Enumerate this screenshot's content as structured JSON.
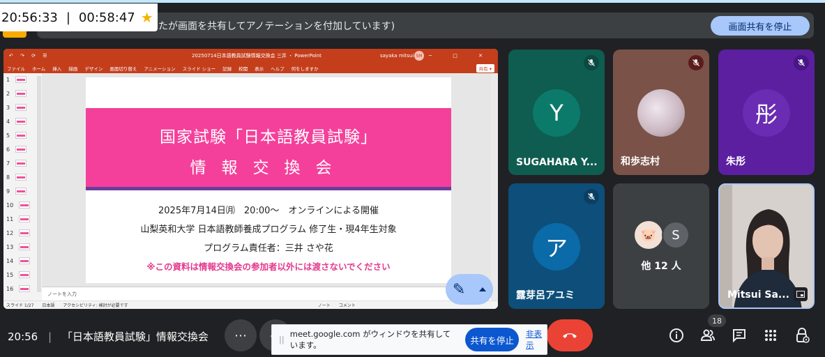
{
  "timer": {
    "elapsed": "20:56:33",
    "separator": "|",
    "remaining": "00:58:47",
    "star_icon": "star-icon"
  },
  "banner": {
    "text": "たが画面を共有してアノテーションを付加しています)",
    "stop_button": "画面共有を停止"
  },
  "ppt": {
    "quick_access": "↶ ↷ ⟳ ☰",
    "filename": "20250714日本語教員試験情報交換会 三井 ・ PowerPoint",
    "user": "sayaka mitsui",
    "user_initials": "SM",
    "window_controls": "─ □ ✕",
    "ribbon_tabs": [
      "ファイル",
      "ホーム",
      "挿入",
      "描画",
      "デザイン",
      "画面切り替え",
      "アニメーション",
      "スライド ショー",
      "記録",
      "校閲",
      "表示",
      "ヘルプ",
      "何をしますか"
    ],
    "share_label": "共有 ▾",
    "thumbnails": [
      "1",
      "2",
      "3",
      "4",
      "5",
      "6",
      "7",
      "8",
      "9",
      "10",
      "11",
      "12",
      "13",
      "14",
      "15",
      "16"
    ],
    "slide": {
      "title1": "国家試験「日本語教員試験」",
      "title2": "情報交換会",
      "line1": "2025年7月14日㈪　20:00～　オンラインによる開催",
      "line2": "山梨英和大学 日本語教師養成プログラム 修了生・現4年生対象",
      "line3": "プログラム責任者：三井 さや花",
      "note": "※この資料は情報交換会の参加者以外には渡さないでください"
    },
    "notes_placeholder": "ノートを入力",
    "status": [
      "スライド 1/27",
      "日本語",
      "アクセシビリティ: 検討が必要です",
      "ノート",
      "コメント"
    ]
  },
  "tiles": [
    {
      "name": "SUGAHARA Y...",
      "initial": "Y",
      "bg": "#0f5c50",
      "avatar_bg": "#0c7a6a",
      "muted": true
    },
    {
      "name": "和歩志村",
      "initial": "",
      "bg": "#7a5248",
      "avatar_bg": "#d9c8cf",
      "muted": true
    },
    {
      "name": "朱彤",
      "initial": "彤",
      "bg": "#5b1fa0",
      "avatar_bg": "#6a2cb3",
      "muted": true
    },
    {
      "name": "露芽呂アユミ",
      "initial": "ア",
      "bg": "#0d4f7a",
      "avatar_bg": "#0b6aa8",
      "muted": true
    },
    {
      "name": "他 12 人",
      "initial": "S",
      "bg": "#3c4043",
      "avatar_bg": "#5f6368",
      "muted": false
    },
    {
      "name": "Mitsui Sa...",
      "initial": "",
      "bg": "#c9c4c0",
      "avatar_bg": "",
      "muted": false
    }
  ],
  "bottom": {
    "time": "20:56",
    "separator": "|",
    "meeting_title": "「日本語教員試験」情報交換会",
    "participant_count": "18",
    "notice_text": "meet.google.com がウィンドウを共有しています。",
    "notice_stop": "共有を停止",
    "notice_hide": "非表示",
    "more_label": "⋯"
  }
}
